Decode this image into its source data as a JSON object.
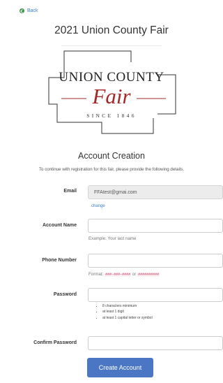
{
  "nav": {
    "back_label": "Back"
  },
  "page": {
    "title": "2021 Union County Fair"
  },
  "logo": {
    "line1": "UNION COUNTY",
    "line2": "Fair",
    "line3": "SINCE 1846"
  },
  "section": {
    "title": "Account Creation",
    "description": "To continue with registration for this fair, please provide the following details."
  },
  "form": {
    "email_label": "Email",
    "email_value": "FFAtest@gmai.com",
    "change_label": "change",
    "account_name_label": "Account Name",
    "account_name_value": "",
    "account_name_hint": "Example: Your last name",
    "phone_label": "Phone Number",
    "phone_value": "",
    "phone_hint_prefix": "Format:",
    "phone_format_1": "###-###-####",
    "phone_hint_or": "or",
    "phone_format_2": "##########",
    "password_label": "Password",
    "password_value": "",
    "password_rules": [
      "8 characters minimum",
      "at least 1 digit",
      "at least 1 capital letter or symbol"
    ],
    "confirm_password_label": "Confirm Password",
    "confirm_password_value": "",
    "submit_label": "Create Account"
  },
  "colors": {
    "back_icon": "#3a9a4a",
    "link": "#3a7dc4",
    "logo_script": "#a32929",
    "button": "#4a76c4",
    "code": "#c7254e"
  }
}
